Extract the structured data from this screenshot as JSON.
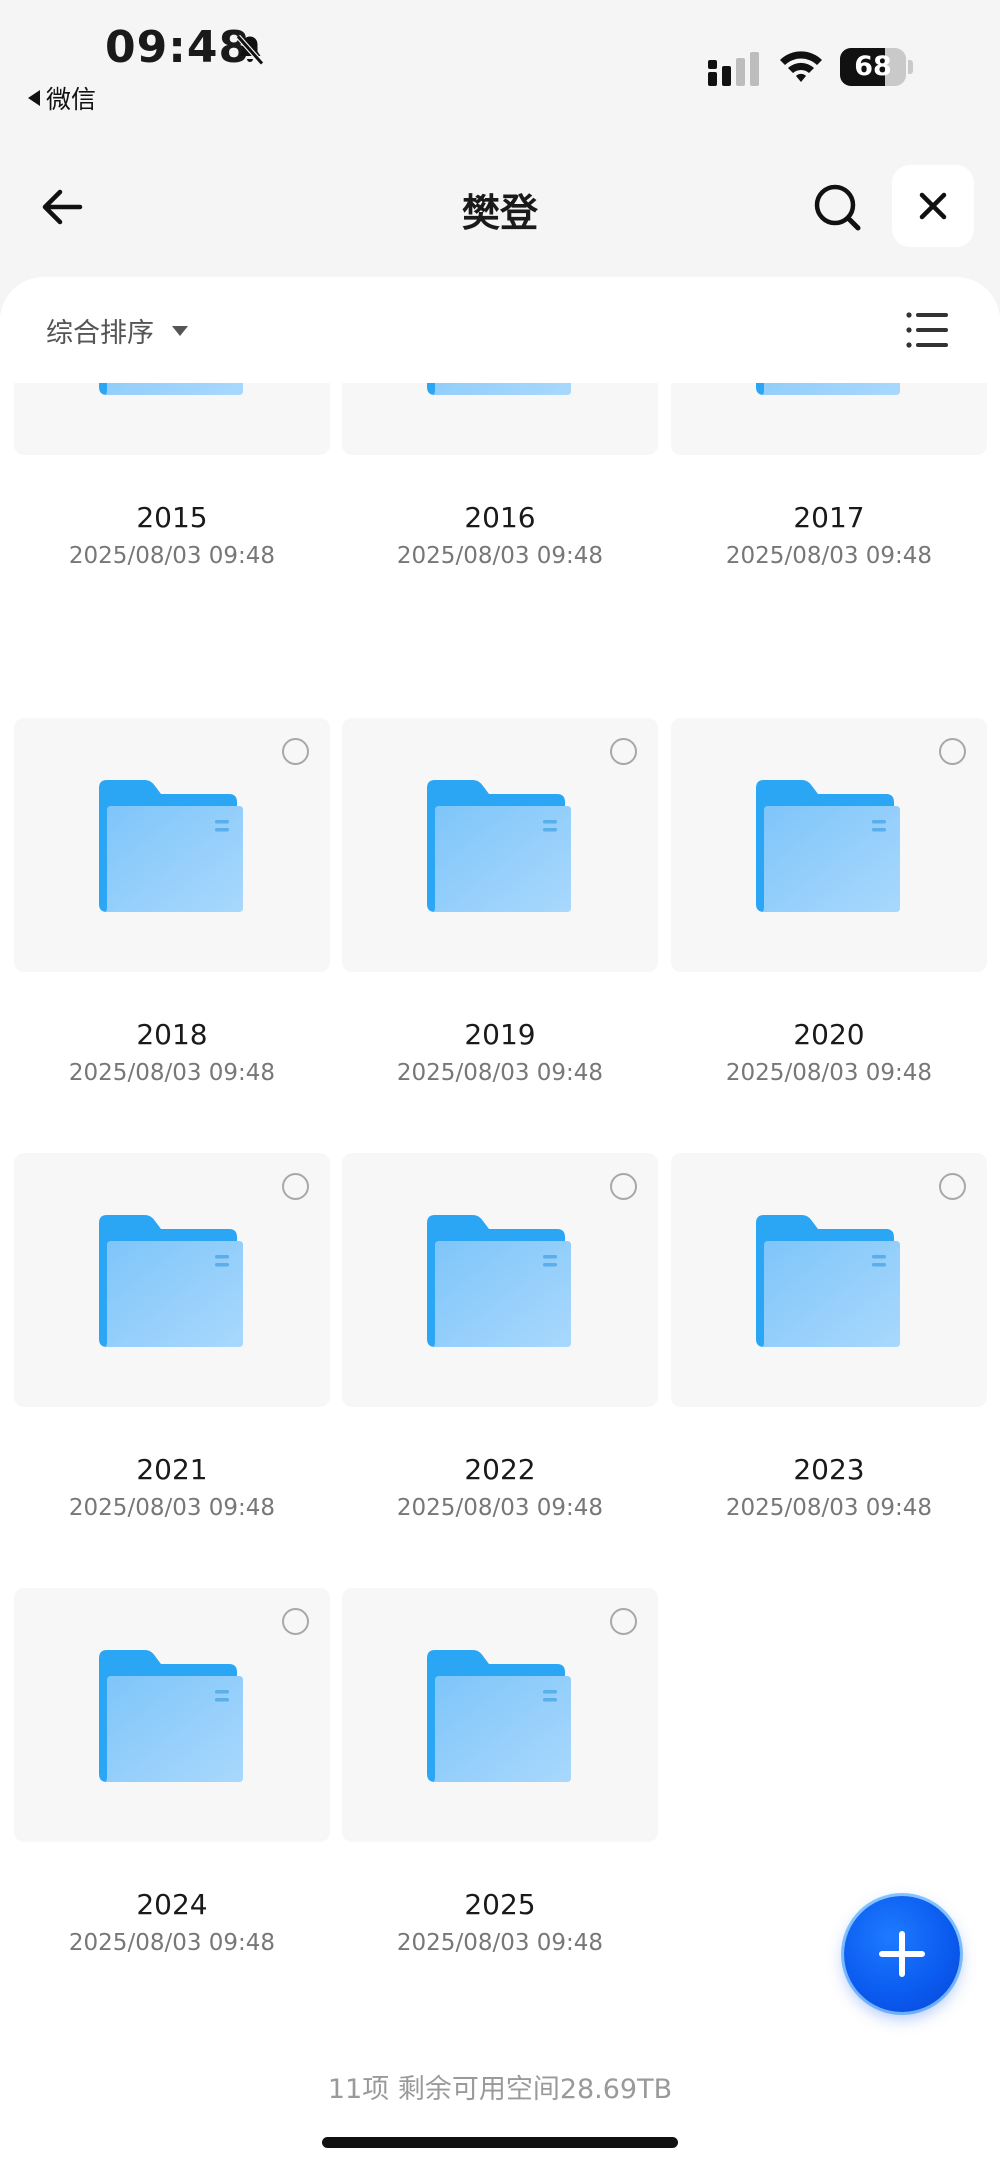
{
  "status_bar": {
    "time": "09:48",
    "back_app": "微信",
    "battery": "68",
    "battery_level": 0.68
  },
  "nav": {
    "title": "樊登"
  },
  "toolbar": {
    "sort_label": "综合排序"
  },
  "folders": [
    {
      "name": "2015",
      "date": "2025/08/03 09:48"
    },
    {
      "name": "2016",
      "date": "2025/08/03 09:48"
    },
    {
      "name": "2017",
      "date": "2025/08/03 09:48"
    },
    {
      "name": "2018",
      "date": "2025/08/03 09:48"
    },
    {
      "name": "2019",
      "date": "2025/08/03 09:48"
    },
    {
      "name": "2020",
      "date": "2025/08/03 09:48"
    },
    {
      "name": "2021",
      "date": "2025/08/03 09:48"
    },
    {
      "name": "2022",
      "date": "2025/08/03 09:48"
    },
    {
      "name": "2023",
      "date": "2025/08/03 09:48"
    },
    {
      "name": "2024",
      "date": "2025/08/03 09:48"
    },
    {
      "name": "2025",
      "date": "2025/08/03 09:48"
    }
  ],
  "footer": {
    "summary": "11项 剩余可用空间28.69TB"
  },
  "colors": {
    "folder_dark": "#2aa6f5",
    "folder_light": "#9fd2fb",
    "fab": "#0b5cf0"
  }
}
